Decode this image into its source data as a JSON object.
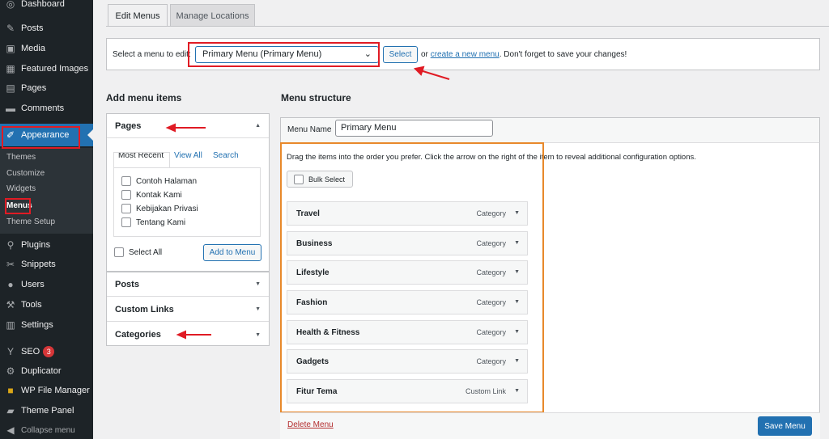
{
  "sidebar": {
    "items": [
      {
        "name": "dashboard",
        "label": "Dashboard",
        "icon": "dashboard-icon"
      },
      {
        "name": "posts",
        "label": "Posts",
        "icon": "pin-icon"
      },
      {
        "name": "media",
        "label": "Media",
        "icon": "media-icon"
      },
      {
        "name": "featured-images",
        "label": "Featured Images",
        "icon": "image-icon"
      },
      {
        "name": "pages",
        "label": "Pages",
        "icon": "page-icon"
      },
      {
        "name": "comments",
        "label": "Comments",
        "icon": "comment-icon"
      },
      {
        "name": "appearance",
        "label": "Appearance",
        "icon": "brush-icon"
      },
      {
        "name": "plugins",
        "label": "Plugins",
        "icon": "plugin-icon"
      },
      {
        "name": "snippets",
        "label": "Snippets",
        "icon": "scissors-icon"
      },
      {
        "name": "users",
        "label": "Users",
        "icon": "user-icon"
      },
      {
        "name": "tools",
        "label": "Tools",
        "icon": "wrench-icon"
      },
      {
        "name": "settings",
        "label": "Settings",
        "icon": "settings-icon"
      },
      {
        "name": "seo",
        "label": "SEO",
        "icon": "seo-icon",
        "badge": "3"
      },
      {
        "name": "duplicator",
        "label": "Duplicator",
        "icon": "duplicator-icon"
      },
      {
        "name": "wp-file-manager",
        "label": "WP File Manager",
        "icon": "folder-icon"
      },
      {
        "name": "theme-panel",
        "label": "Theme Panel",
        "icon": "theme-panel-icon"
      },
      {
        "name": "collapse-menu",
        "label": "Collapse menu",
        "icon": "collapse-icon"
      }
    ],
    "submenu": [
      "Themes",
      "Customize",
      "Widgets",
      "Menus",
      "Theme Setup"
    ]
  },
  "tabs": {
    "edit_menus": "Edit Menus",
    "manage_locations": "Manage Locations"
  },
  "select_bar": {
    "prompt": "Select a menu to edit:",
    "selected_menu": "Primary Menu (Primary Menu)",
    "select_button": "Select",
    "or_text": "or",
    "create_link": "create a new menu",
    "reminder": ". Don't forget to save your changes!"
  },
  "add_items": {
    "heading": "Add menu items",
    "pages_label": "Pages",
    "subtabs": [
      "Most Recent",
      "View All",
      "Search"
    ],
    "pages": [
      "Contoh Halaman",
      "Kontak Kami",
      "Kebijakan Privasi",
      "Tentang Kami"
    ],
    "select_all": "Select All",
    "add_button": "Add to Menu",
    "posts_label": "Posts",
    "custom_links_label": "Custom Links",
    "categories_label": "Categories"
  },
  "structure": {
    "heading": "Menu structure",
    "menu_name_label": "Menu Name",
    "menu_name_value": "Primary Menu",
    "instructions": "Drag the items into the order you prefer. Click the arrow on the right of the item to reveal additional configuration options.",
    "bulk_select": "Bulk Select",
    "items": [
      {
        "title": "Travel",
        "type": "Category"
      },
      {
        "title": "Business",
        "type": "Category"
      },
      {
        "title": "Lifestyle",
        "type": "Category"
      },
      {
        "title": "Fashion",
        "type": "Category"
      },
      {
        "title": "Health & Fitness",
        "type": "Category"
      },
      {
        "title": "Gadgets",
        "type": "Category"
      },
      {
        "title": "Fitur Tema",
        "type": "Custom Link"
      }
    ],
    "delete_menu": "Delete Menu",
    "save_button": "Save Menu"
  },
  "colors": {
    "accent": "#2271b1",
    "sidebar_bg": "#1d2327",
    "annotation_red": "#e01b24",
    "annotation_orange": "#e8892b"
  }
}
